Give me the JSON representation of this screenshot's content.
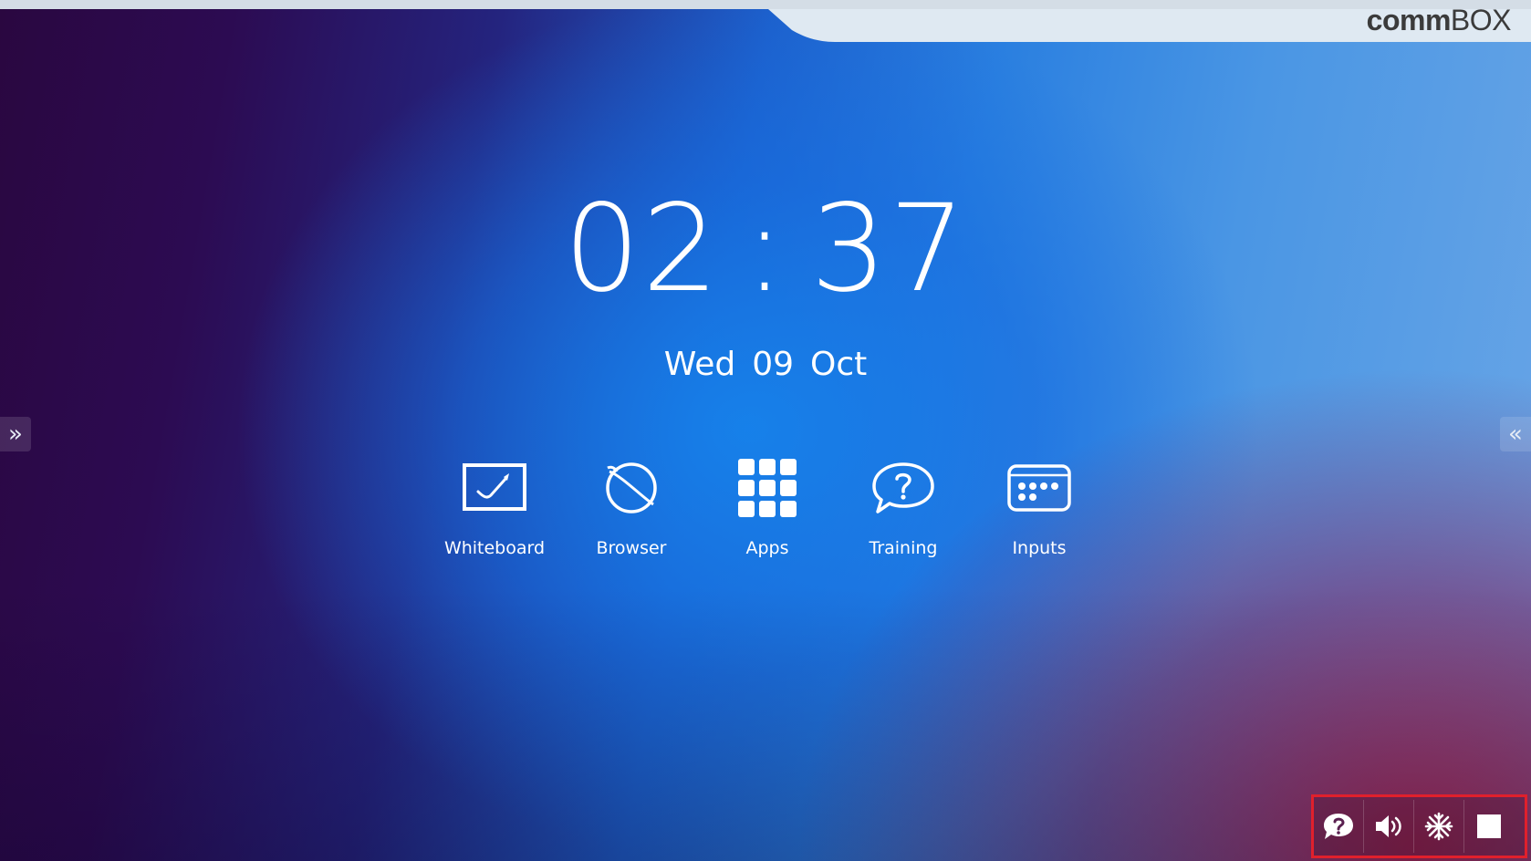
{
  "brand": {
    "logo_bold": "comm",
    "logo_light": "BOX"
  },
  "clock": {
    "hours": "02",
    "separator": ":",
    "minutes": "37"
  },
  "date": {
    "weekday": "Wed",
    "day": "09",
    "month": "Oct"
  },
  "sidebar": {
    "left_arrow": "»",
    "right_arrow": "«"
  },
  "apps": [
    {
      "label": "Whiteboard",
      "icon": "whiteboard-icon"
    },
    {
      "label": "Browser",
      "icon": "browser-icon"
    },
    {
      "label": "Apps",
      "icon": "apps-grid-icon"
    },
    {
      "label": "Training",
      "icon": "training-icon"
    },
    {
      "label": "Inputs",
      "icon": "inputs-icon"
    }
  ],
  "tray": [
    {
      "icon": "help-icon"
    },
    {
      "icon": "volume-icon"
    },
    {
      "icon": "freeze-icon"
    },
    {
      "icon": "screen-icon"
    }
  ],
  "colors": {
    "tray_highlight": "#e0202c",
    "brand_bar": "#dfe9f2"
  }
}
